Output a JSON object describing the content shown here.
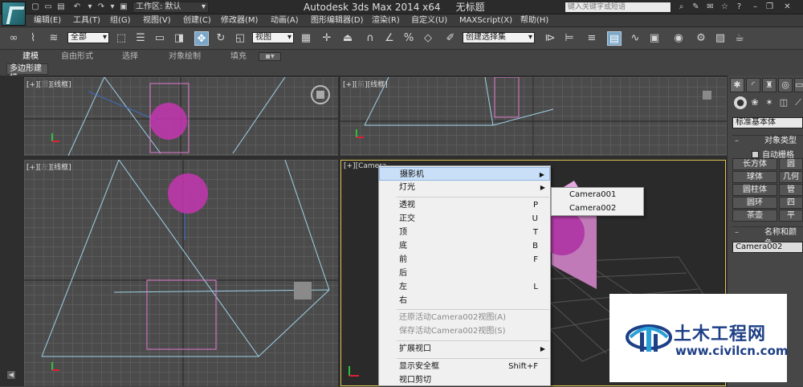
{
  "titlebar": {
    "workspace": "工作区: 默认",
    "app_title": "Autodesk 3ds Max  2014 x64",
    "doc_title": "无标题",
    "search_placeholder": "键入关键字或短语"
  },
  "menubar": {
    "items": [
      "编辑(E)",
      "工具(T)",
      "组(G)",
      "视图(V)",
      "创建(C)",
      "修改器(M)",
      "动画(A)",
      "图形编辑器(D)",
      "渲染(R)",
      "自定义(U)",
      "MAXScript(X)",
      "帮助(H)"
    ]
  },
  "toolbar": {
    "selection_filter": "全部",
    "ref_coord": "视图",
    "named_selection": "创建选择集"
  },
  "ribbon": {
    "tabs": [
      "建模",
      "自由形式",
      "选择",
      "对象绘制",
      "填充"
    ],
    "subtab": "多边形建模"
  },
  "viewports": {
    "top_left": {
      "label_a": "[+][",
      "label_b": "顶",
      "label_c": "][线框]"
    },
    "top_right": {
      "label_a": "[+][",
      "label_b": "前",
      "label_c": "][线框]"
    },
    "bottom_left": {
      "label_a": "[+][",
      "label_b": "左",
      "label_c": "][线框]"
    },
    "camera": {
      "label": "[+][Camera"
    }
  },
  "context_menu": {
    "items": [
      {
        "label": "摄影机",
        "shortcut": "",
        "submenu": true,
        "disabled": false,
        "highlight": true
      },
      {
        "label": "灯光",
        "shortcut": "",
        "submenu": true,
        "disabled": false,
        "highlight": false
      },
      {
        "label": "透视",
        "shortcut": "P",
        "submenu": false,
        "disabled": false,
        "highlight": false
      },
      {
        "label": "正交",
        "shortcut": "U",
        "submenu": false,
        "disabled": false,
        "highlight": false
      },
      {
        "label": "顶",
        "shortcut": "T",
        "submenu": false,
        "disabled": false,
        "highlight": false
      },
      {
        "label": "底",
        "shortcut": "B",
        "submenu": false,
        "disabled": false,
        "highlight": false
      },
      {
        "label": "前",
        "shortcut": "F",
        "submenu": false,
        "disabled": false,
        "highlight": false
      },
      {
        "label": "后",
        "shortcut": "",
        "submenu": false,
        "disabled": false,
        "highlight": false
      },
      {
        "label": "左",
        "shortcut": "L",
        "submenu": false,
        "disabled": false,
        "highlight": false
      },
      {
        "label": "右",
        "shortcut": "",
        "submenu": false,
        "disabled": false,
        "highlight": false
      },
      {
        "label": "还原活动Camera002视图(A)",
        "shortcut": "",
        "submenu": false,
        "disabled": true,
        "highlight": false
      },
      {
        "label": "保存活动Camera002视图(S)",
        "shortcut": "",
        "submenu": false,
        "disabled": true,
        "highlight": false
      },
      {
        "label": "扩展视口",
        "shortcut": "",
        "submenu": true,
        "disabled": false,
        "highlight": false
      },
      {
        "label": "显示安全框",
        "shortcut": "Shift+F",
        "submenu": false,
        "disabled": false,
        "highlight": false
      },
      {
        "label": "视口剪切",
        "shortcut": "",
        "submenu": false,
        "disabled": false,
        "highlight": false
      }
    ],
    "camera_submenu": [
      "Camera001",
      "Camera002"
    ]
  },
  "command_panel": {
    "dropdown": "标准基本体",
    "object_type_title": "对象类型",
    "autogrid": "自动栅格",
    "buttons": [
      "长方体",
      "圆",
      "球体",
      "几何",
      "圆柱体",
      "管",
      "圆环",
      "四",
      "茶壶",
      "平"
    ],
    "name_color_title": "名称和颜色",
    "name_value": "Camera002"
  },
  "watermark": {
    "brand": "土木工程网",
    "url": "www.civilcn.com"
  },
  "colors": {
    "accent": "#7aa7c7",
    "camera_border": "#e0c350",
    "wire": "#9fd3e8",
    "magenta": "#d040c0",
    "watermark_blue": "#1d3f86"
  }
}
